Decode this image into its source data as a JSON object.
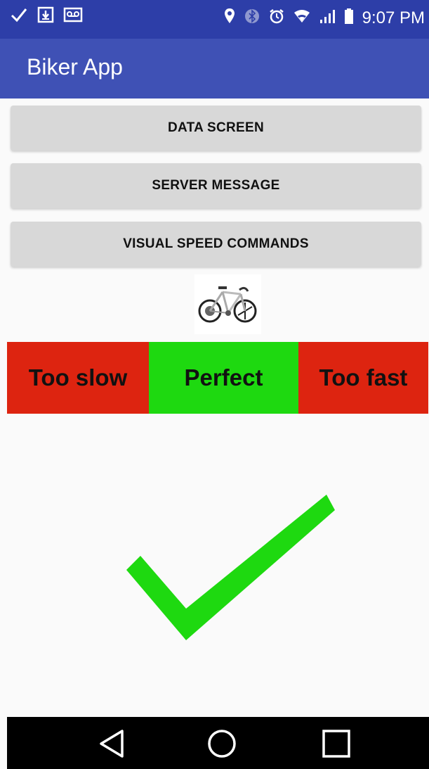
{
  "status_bar": {
    "time": "9:07 PM",
    "left_icons": [
      "check-icon",
      "download-icon",
      "voicemail-icon"
    ],
    "right_icons": [
      "location-icon",
      "bluetooth-icon",
      "alarm-icon",
      "wifi-icon",
      "signal-icon",
      "battery-icon"
    ]
  },
  "app_bar": {
    "title": "Biker App"
  },
  "buttons": {
    "data_screen": "DATA SCREEN",
    "server_message": "SERVER MESSAGE",
    "visual_speed_commands": "VISUAL SPEED COMMANDS"
  },
  "speed_indicator": {
    "too_slow": "Too slow",
    "perfect": "Perfect",
    "too_fast": "Too fast",
    "current": "Perfect"
  },
  "colors": {
    "status_bar": "#2d3ea8",
    "app_bar": "#3f51b5",
    "slow_fast": "#dd2410",
    "perfect": "#1ed910",
    "checkmark": "#1ed910"
  },
  "nav_bar": {
    "icons": [
      "back-icon",
      "home-icon",
      "recents-icon"
    ]
  }
}
